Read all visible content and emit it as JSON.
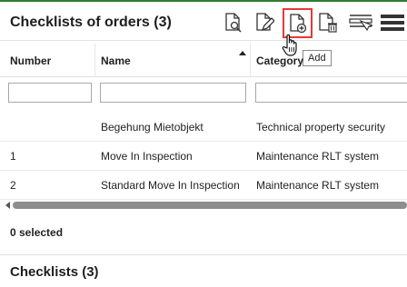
{
  "header": {
    "title": "Checklists of orders (3)",
    "toolbar": {
      "tooltip": "Add",
      "icons": [
        "document-search-icon",
        "document-edit-icon",
        "document-add-icon",
        "document-delete-icon",
        "filter-list-icon",
        "menu-icon"
      ]
    }
  },
  "table": {
    "columns": [
      "Number",
      "Name",
      "Category"
    ],
    "rows": [
      {
        "number": "",
        "name": "Begehung Mietobjekt",
        "category": "Technical property security"
      },
      {
        "number": "1",
        "name": "Move In Inspection",
        "category": "Maintenance RLT system"
      },
      {
        "number": "2",
        "name": "Standard Move In Inspection",
        "category": "Maintenance RLT system"
      }
    ]
  },
  "status": {
    "selected": "0 selected"
  },
  "section2": {
    "title": "Checklists (3)"
  },
  "colors": {
    "accent": "#2e7d32",
    "highlight": "#e53935"
  }
}
